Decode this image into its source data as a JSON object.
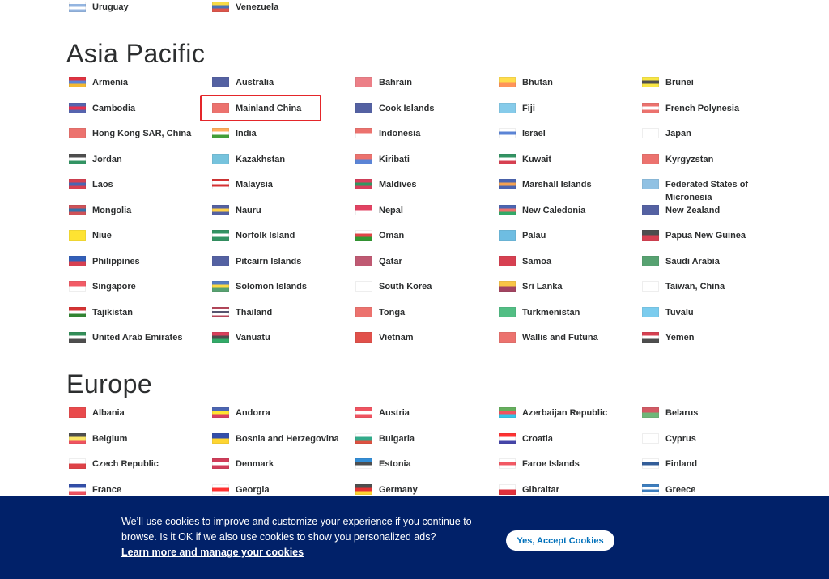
{
  "top_countries": [
    {
      "name": "Uruguay",
      "flag": [
        "#ffffff",
        "#7aa3d9",
        "#ffffff",
        "#7aa3d9"
      ]
    },
    {
      "name": "Venezuela",
      "flag": [
        "#f7d117",
        "#1f4fa3",
        "#d52b1e"
      ]
    }
  ],
  "asia": {
    "heading": "Asia Pacific",
    "countries": [
      {
        "name": "Armenia",
        "flag": [
          "#d90012",
          "#3366cc",
          "#f2a800"
        ]
      },
      {
        "name": "Australia",
        "flag": [
          "#2a3a8c",
          "#2a3a8c"
        ]
      },
      {
        "name": "Bahrain",
        "flag": [
          "#e8606a",
          "#e8606a"
        ]
      },
      {
        "name": "Bhutan",
        "flag": [
          "#ffd520",
          "#ff7a30"
        ]
      },
      {
        "name": "Brunei",
        "flag": [
          "#f7e017",
          "#222222",
          "#f7e017"
        ]
      },
      {
        "name": "Cambodia",
        "flag": [
          "#2c3e9c",
          "#e00025",
          "#2c3e9c"
        ]
      },
      {
        "name": "Mainland China",
        "flag": [
          "#e8504a",
          "#e8504a"
        ]
      },
      {
        "name": "Cook Islands",
        "flag": [
          "#2a3a8c",
          "#2a3a8c"
        ]
      },
      {
        "name": "Fiji",
        "flag": [
          "#68bfe5",
          "#68bfe5"
        ]
      },
      {
        "name": "French Polynesia",
        "flag": [
          "#e8504a",
          "#ffffff",
          "#e8504a"
        ]
      },
      {
        "name": "Hong Kong SAR, China",
        "flag": [
          "#e8504a",
          "#e8504a"
        ]
      },
      {
        "name": "India",
        "flag": [
          "#ff9933",
          "#ffffff",
          "#138808"
        ]
      },
      {
        "name": "Indonesia",
        "flag": [
          "#e8504a",
          "#ffffff"
        ]
      },
      {
        "name": "Israel",
        "flag": [
          "#ffffff",
          "#3366cc",
          "#ffffff"
        ]
      },
      {
        "name": "Japan",
        "flag": [
          "#ffffff",
          "#ffffff"
        ]
      },
      {
        "name": "Jordan",
        "flag": [
          "#222222",
          "#ffffff",
          "#007a3d"
        ]
      },
      {
        "name": "Kazakhstan",
        "flag": [
          "#55b5d5",
          "#55b5d5"
        ]
      },
      {
        "name": "Kiribati",
        "flag": [
          "#e8504a",
          "#3366cc"
        ]
      },
      {
        "name": "Kuwait",
        "flag": [
          "#007a3d",
          "#ffffff",
          "#ce1126"
        ]
      },
      {
        "name": "Kyrgyzstan",
        "flag": [
          "#e8504a",
          "#e8504a"
        ]
      },
      {
        "name": "Laos",
        "flag": [
          "#ce1126",
          "#1f3fa0",
          "#ce1126"
        ]
      },
      {
        "name": "Malaysia",
        "flag": [
          "#cc0001",
          "#ffffff",
          "#cc0001",
          "#ffffff"
        ]
      },
      {
        "name": "Maldives",
        "flag": [
          "#d21034",
          "#007e3a",
          "#d21034"
        ]
      },
      {
        "name": "Marshall Islands",
        "flag": [
          "#1f3fa0",
          "#f28c28",
          "#1f3fa0"
        ]
      },
      {
        "name": "Federated States of Micronesia",
        "flag": [
          "#75b2dd",
          "#75b2dd"
        ]
      },
      {
        "name": "Mongolia",
        "flag": [
          "#c4272f",
          "#015197",
          "#c4272f"
        ]
      },
      {
        "name": "Nauru",
        "flag": [
          "#2a3a8c",
          "#ffc61e",
          "#2a3a8c"
        ]
      },
      {
        "name": "Nepal",
        "flag": [
          "#dc143c",
          "#ffffff"
        ]
      },
      {
        "name": "New Caledonia",
        "flag": [
          "#1f3fa0",
          "#e8504a",
          "#009543"
        ]
      },
      {
        "name": "New Zealand",
        "flag": [
          "#2a3a8c",
          "#2a3a8c"
        ]
      },
      {
        "name": "Niue",
        "flag": [
          "#fedd00",
          "#fedd00"
        ]
      },
      {
        "name": "Norfolk Island",
        "flag": [
          "#007a3d",
          "#ffffff",
          "#007a3d"
        ]
      },
      {
        "name": "Oman",
        "flag": [
          "#ffffff",
          "#db161b",
          "#008000"
        ]
      },
      {
        "name": "Palau",
        "flag": [
          "#4aaddb",
          "#4aaddb"
        ]
      },
      {
        "name": "Papua New Guinea",
        "flag": [
          "#222222",
          "#ce1126"
        ]
      },
      {
        "name": "Philippines",
        "flag": [
          "#0038a8",
          "#ce1126"
        ]
      },
      {
        "name": "Pitcairn Islands",
        "flag": [
          "#2a3a8c",
          "#2a3a8c"
        ]
      },
      {
        "name": "Qatar",
        "flag": [
          "#b03050",
          "#b03050"
        ]
      },
      {
        "name": "Samoa",
        "flag": [
          "#ce1126",
          "#ce1126"
        ]
      },
      {
        "name": "Saudi Arabia",
        "flag": [
          "#2e8b4e",
          "#2e8b4e"
        ]
      },
      {
        "name": "Singapore",
        "flag": [
          "#ef3340",
          "#ffffff"
        ]
      },
      {
        "name": "Solomon Islands",
        "flag": [
          "#2b5fb4",
          "#fcd116",
          "#2e8b4e"
        ]
      },
      {
        "name": "South Korea",
        "flag": [
          "#ffffff",
          "#ffffff"
        ]
      },
      {
        "name": "Sri Lanka",
        "flag": [
          "#f7b718",
          "#8d153a"
        ]
      },
      {
        "name": "Taiwan, China",
        "flag": [
          "#ffffff",
          "#ffffff"
        ]
      },
      {
        "name": "Tajikistan",
        "flag": [
          "#cc0000",
          "#ffffff",
          "#006600"
        ]
      },
      {
        "name": "Thailand",
        "flag": [
          "#a51931",
          "#ffffff",
          "#2d2a4a",
          "#ffffff",
          "#a51931"
        ]
      },
      {
        "name": "Tonga",
        "flag": [
          "#e8504a",
          "#e8504a"
        ]
      },
      {
        "name": "Turkmenistan",
        "flag": [
          "#28ae66",
          "#28ae66"
        ]
      },
      {
        "name": "Tuvalu",
        "flag": [
          "#5bc0eb",
          "#5bc0eb"
        ]
      },
      {
        "name": "United Arab Emirates",
        "flag": [
          "#00732f",
          "#ffffff",
          "#222222"
        ]
      },
      {
        "name": "Vanuatu",
        "flag": [
          "#d21034",
          "#222222",
          "#009543"
        ]
      },
      {
        "name": "Vietnam",
        "flag": [
          "#da251d",
          "#da251d"
        ]
      },
      {
        "name": "Wallis and Futuna",
        "flag": [
          "#e8504a",
          "#e8504a"
        ]
      },
      {
        "name": "Yemen",
        "flag": [
          "#ce1126",
          "#ffffff",
          "#222222"
        ]
      }
    ]
  },
  "europe": {
    "heading": "Europe",
    "countries": [
      {
        "name": "Albania",
        "flag": [
          "#e41e20",
          "#e41e20"
        ]
      },
      {
        "name": "Andorra",
        "flag": [
          "#1f3fa0",
          "#fedf00",
          "#d0103a"
        ]
      },
      {
        "name": "Austria",
        "flag": [
          "#ed2939",
          "#ffffff",
          "#ed2939"
        ]
      },
      {
        "name": "Azerbaijan Republic",
        "flag": [
          "#3f9c35",
          "#ed2939",
          "#00b9e4"
        ]
      },
      {
        "name": "Belarus",
        "flag": [
          "#c8313e",
          "#4aa657"
        ]
      },
      {
        "name": "Belgium",
        "flag": [
          "#222222",
          "#fae042",
          "#ed2939"
        ]
      },
      {
        "name": "Bosnia and Herzegovina",
        "flag": [
          "#002395",
          "#fecb00"
        ]
      },
      {
        "name": "Bulgaria",
        "flag": [
          "#ffffff",
          "#00966e",
          "#d62612"
        ]
      },
      {
        "name": "Croatia",
        "flag": [
          "#ff0000",
          "#ffffff",
          "#171796"
        ]
      },
      {
        "name": "Cyprus",
        "flag": [
          "#ffffff",
          "#ffffff"
        ]
      },
      {
        "name": "Czech Republic",
        "flag": [
          "#ffffff",
          "#d7141a"
        ]
      },
      {
        "name": "Denmark",
        "flag": [
          "#c60c30",
          "#ffffff",
          "#c60c30"
        ]
      },
      {
        "name": "Estonia",
        "flag": [
          "#0072ce",
          "#222222",
          "#ffffff"
        ]
      },
      {
        "name": "Faroe Islands",
        "flag": [
          "#ffffff",
          "#ef303e",
          "#ffffff"
        ]
      },
      {
        "name": "Finland",
        "flag": [
          "#ffffff",
          "#003580",
          "#ffffff"
        ]
      },
      {
        "name": "France",
        "flag": [
          "#002395",
          "#ffffff",
          "#ed2939"
        ]
      },
      {
        "name": "Georgia",
        "flag": [
          "#ffffff",
          "#ff0000",
          "#ffffff"
        ]
      },
      {
        "name": "Germany",
        "flag": [
          "#222222",
          "#dd0000",
          "#ffce00"
        ]
      },
      {
        "name": "Gibraltar",
        "flag": [
          "#ffffff",
          "#da000c"
        ]
      },
      {
        "name": "Greece",
        "flag": [
          "#0d5eaf",
          "#ffffff",
          "#0d5eaf",
          "#ffffff"
        ]
      }
    ]
  },
  "highlighted_country": "Mainland China",
  "cookie_banner": {
    "message": "We’ll use cookies to improve and customize your experience if you continue to browse. Is it OK if we also use cookies to show you personalized ads?",
    "link": "Learn more and manage your cookies",
    "accept_button": "Yes, Accept Cookies",
    "background": "#012169"
  }
}
